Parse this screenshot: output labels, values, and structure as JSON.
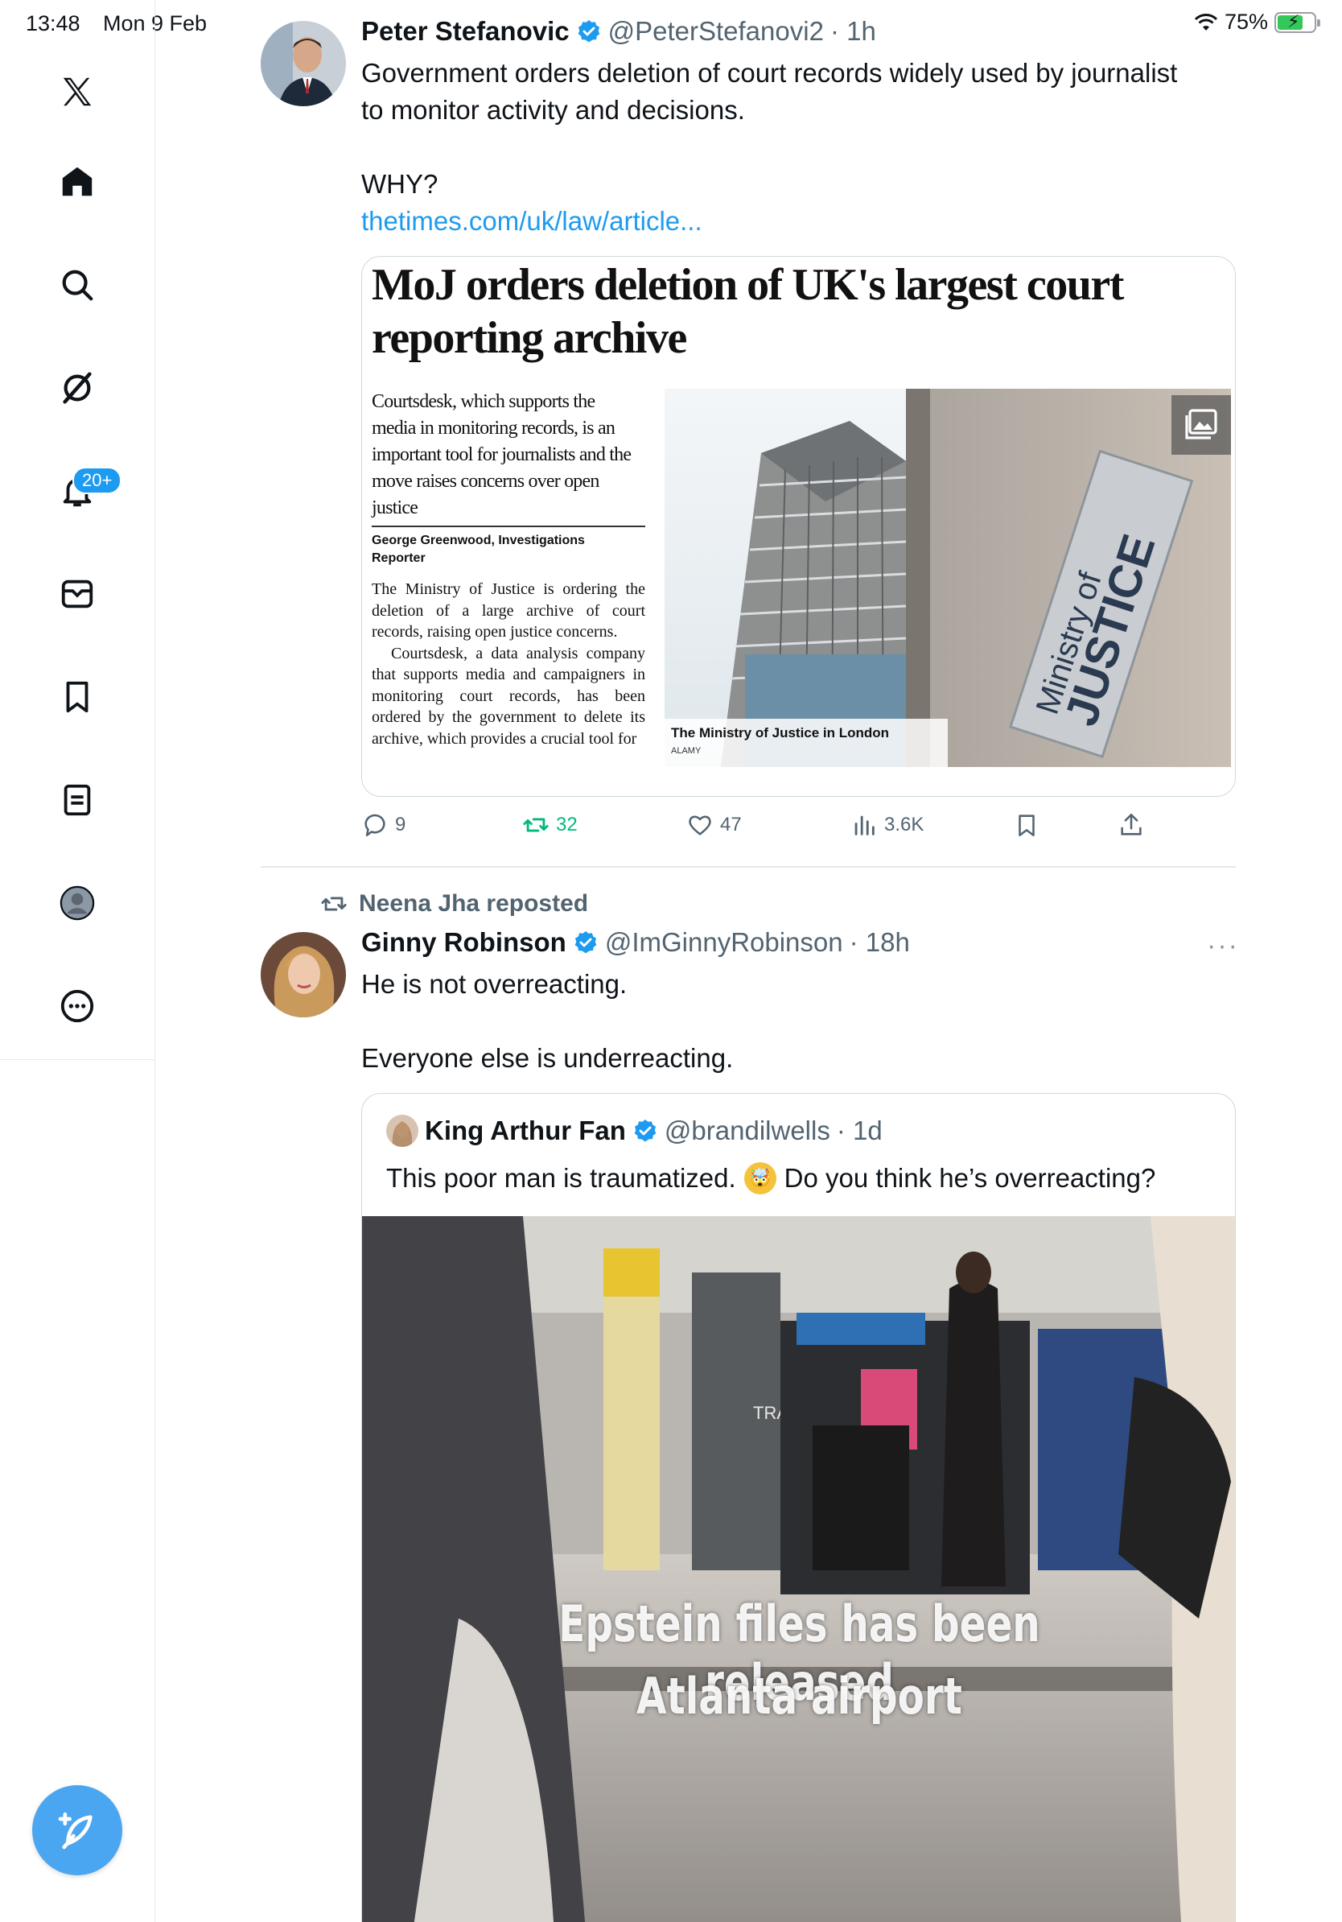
{
  "status_bar": {
    "time": "13:48",
    "date": "Mon 9 Feb",
    "battery": "75%"
  },
  "sidebar": {
    "notifications_badge": "20+",
    "items": [
      "x-logo",
      "home",
      "search",
      "grok",
      "notifications",
      "messages",
      "bookmarks",
      "lists",
      "profile",
      "more"
    ]
  },
  "tweet1": {
    "name": "Peter Stefanovic",
    "handle": "@PeterStefanovi2",
    "time": "· 1h",
    "text_line1": "Government orders deletion of court records widely used by journalist",
    "text_line2": "to monitor activity and decisions.",
    "text_line3": "WHY?",
    "link": "thetimes.com/uk/law/article...",
    "article": {
      "headline": "MoJ orders deletion of UK's largest court reporting archive",
      "standfirst": "Courtsdesk, which supports the media in monitoring records, is an important tool for journalists and the move raises concerns over open justice",
      "byline": "George Greenwood, Investigations Reporter",
      "body_p1": "The Ministry of Justice is ordering the deletion of a large archive of court records, raising open justice concerns.",
      "body_p2": "Courtsdesk, a data analysis company that supports media and campaigners in monitoring court records, has been ordered by the government to delete its archive, which provides a crucial tool for",
      "photo_caption": "The Ministry of Justice in London",
      "photo_credit": "ALAMY",
      "sign_line1": "Ministry of",
      "sign_line2": "JUSTICE"
    },
    "replies": "9",
    "reposts": "32",
    "likes": "47",
    "views": "3.6K"
  },
  "tweet2": {
    "reposted_by": "Neena Jha reposted",
    "name": "Ginny Robinson",
    "handle": "@ImGinnyRobinson",
    "time": "· 18h",
    "more": "···",
    "text_line1": "He is not overreacting.",
    "text_line2": "Everyone else is underreacting.",
    "quote": {
      "name": "King Arthur Fan",
      "handle": "@brandilwells",
      "time": "· 1d",
      "text": "This poor man is traumatized.",
      "text_after": "Do you think he’s overreacting?",
      "emoji": "🤯",
      "video_caption_line1": "Epstein files has been released",
      "video_caption_line2": "Atlanta airport",
      "bin_label": "TRASH"
    }
  },
  "colors": {
    "accent": "#1d9bf0",
    "repost_green": "#00ba7c",
    "secondary_text": "#536471",
    "divider": "#e6e9eb"
  }
}
